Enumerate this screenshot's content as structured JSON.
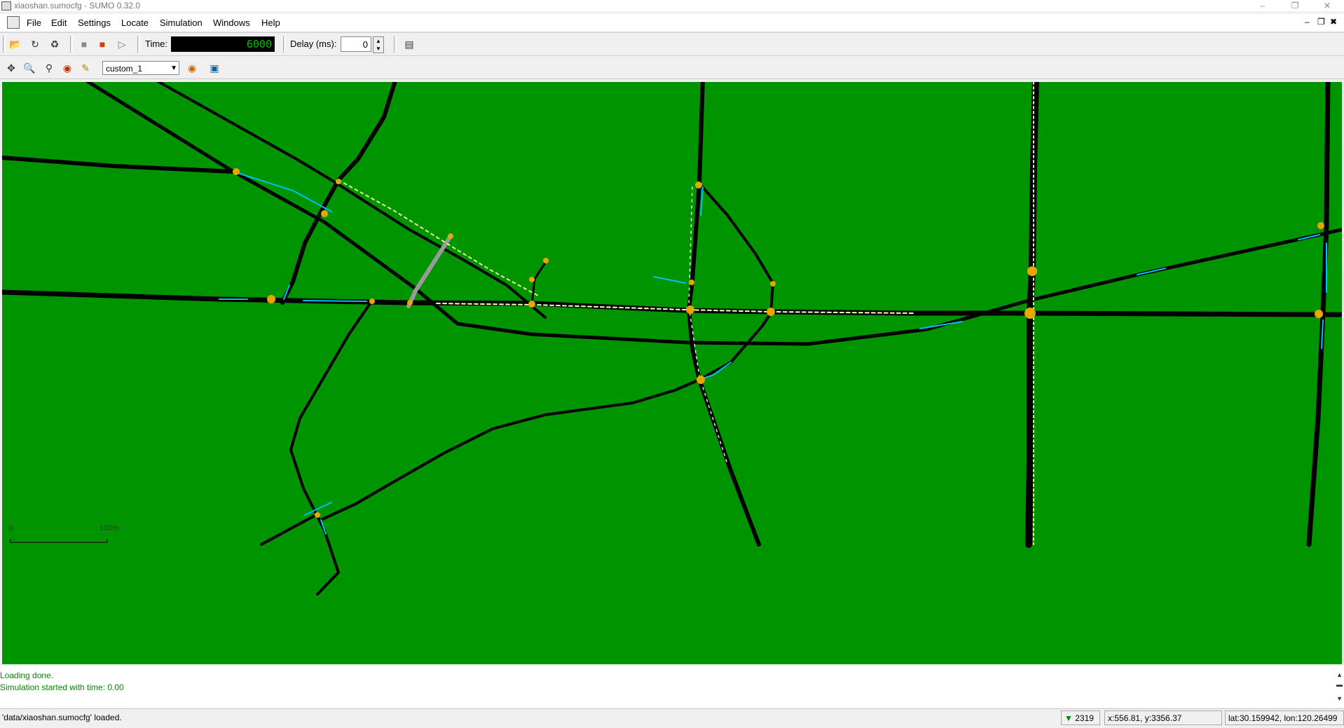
{
  "window": {
    "title": "xiaoshan.sumocfg - SUMO 0.32.0",
    "minimize_icon": "minimize-icon",
    "maximize_icon": "restore-icon",
    "close_icon": "close-icon"
  },
  "menubar": {
    "items": [
      "File",
      "Edit",
      "Settings",
      "Locate",
      "Simulation",
      "Windows",
      "Help"
    ]
  },
  "toolbar": {
    "time_label": "Time:",
    "time_value": "6000",
    "delay_label": "Delay (ms):",
    "delay_value": "0",
    "buttons": [
      "open-icon",
      "reload-icon",
      "open-network-icon",
      "stop-icon",
      "run-icon",
      "step-icon",
      "editor-icon"
    ]
  },
  "viewtools": {
    "scheme_value": "custom_1",
    "buttons": [
      "recenter-icon",
      "zoom-icon",
      "locate-icon",
      "color-icon",
      "tooltip-icon",
      "scheme-color-icon",
      "screenshot-icon"
    ]
  },
  "map": {
    "scale_start": "0",
    "scale_end": "100m",
    "colors": {
      "background": "#009400",
      "road": "#000000",
      "lane_marking": "#00bfff",
      "junction": "#e6a800"
    }
  },
  "log": {
    "lines": [
      "Loading done.",
      "Simulation started with time: 0.00"
    ]
  },
  "status": {
    "message": "'data/xiaoshan.sumocfg' loaded.",
    "vehicles": "2319",
    "xy": "x:556.81, y:3356.37",
    "latlon": "lat:30.159942, lon:120.26499"
  }
}
